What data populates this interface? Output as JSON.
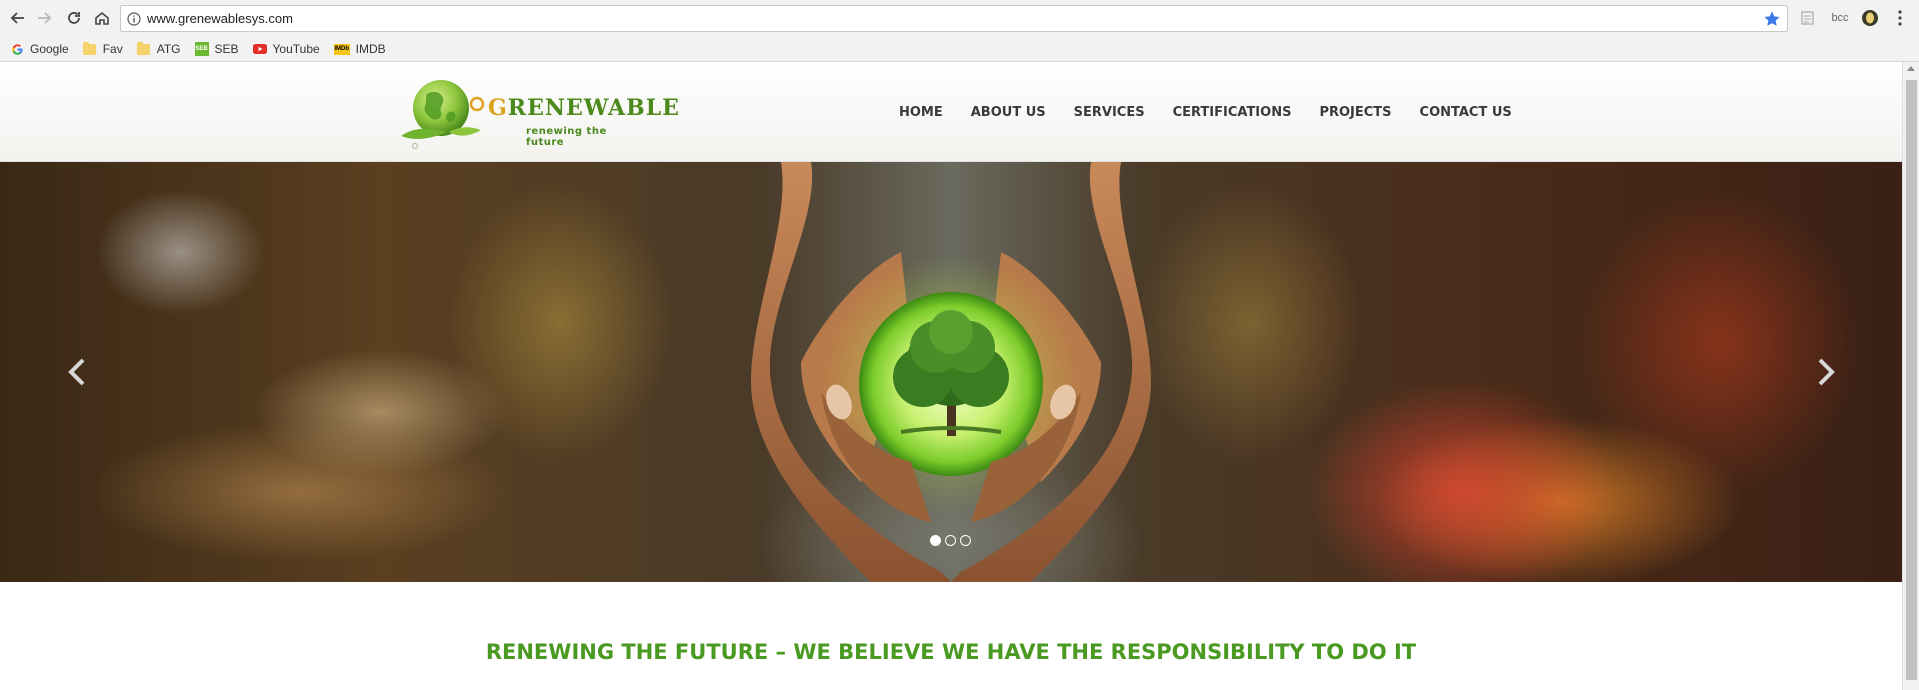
{
  "browser": {
    "url": "www.grenewablesys.com",
    "extension_label": "bcc",
    "bookmarks": [
      {
        "label": "Google",
        "icon": "google-icon"
      },
      {
        "label": "Fav",
        "icon": "folder-icon"
      },
      {
        "label": "ATG",
        "icon": "folder-icon"
      },
      {
        "label": "SEB",
        "icon": "seb-icon"
      },
      {
        "label": "YouTube",
        "icon": "youtube-icon"
      },
      {
        "label": "IMDB",
        "icon": "imdb-icon"
      }
    ]
  },
  "site": {
    "logo_text": "RENEWABLE",
    "logo_initial": "G",
    "logo_tagline": "renewing the future",
    "nav": [
      "HOME",
      "ABOUT US",
      "SERVICES",
      "CERTIFICATIONS",
      "PROJECTS",
      "CONTACT US"
    ],
    "tagline": "RENEWING THE FUTURE – WE BELIEVE WE HAVE THE RESPONSIBILITY TO DO IT"
  },
  "slider": {
    "slide_count": 3,
    "active_slide": 1
  },
  "colors": {
    "brand_green": "#4a9a22",
    "logo_green": "#4a8a1c",
    "star_blue": "#3b78e7"
  }
}
